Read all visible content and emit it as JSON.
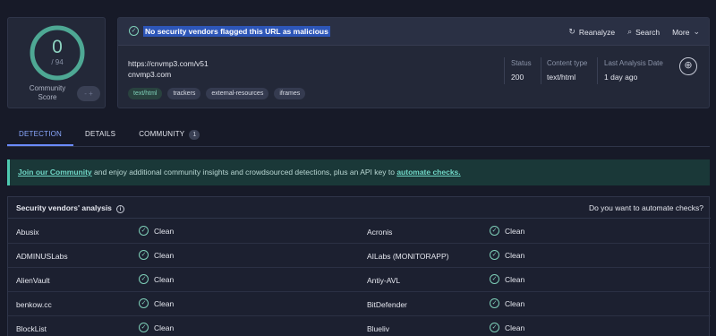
{
  "score": {
    "value": "0",
    "total": "/ 94",
    "community_label": "Community Score",
    "toggle_icon": "- +"
  },
  "banner": {
    "icon": "check-circle-icon",
    "text": "No security vendors flagged this URL as malicious",
    "actions": [
      {
        "label": "Reanalyze",
        "icon": "↻"
      },
      {
        "label": "Search",
        "icon": "⌕"
      },
      {
        "label": "More",
        "icon": "⌄"
      }
    ]
  },
  "target": {
    "url": "https://cnvmp3.com/v51",
    "domain": "cnvmp3.com",
    "tags": [
      "text/html",
      "trackers",
      "external-resources",
      "iframes"
    ]
  },
  "meta": [
    {
      "label": "Status",
      "value": "200"
    },
    {
      "label": "Content type",
      "value": "text/html"
    },
    {
      "label": "Last Analysis Date",
      "value": "1 day ago"
    }
  ],
  "tabs": [
    {
      "label": "DETECTION",
      "active": true
    },
    {
      "label": "DETAILS",
      "active": false
    },
    {
      "label": "COMMUNITY",
      "active": false,
      "badge": "1"
    }
  ],
  "promo": {
    "link1": "Join our Community",
    "middle": " and enjoy additional community insights and crowdsourced detections, plus an API key to ",
    "link2": "automate checks."
  },
  "vendors": {
    "title": "Security vendors' analysis",
    "automate_question": "Do you want to automate checks?",
    "rows": [
      {
        "left": "Abusix",
        "left_verdict": "Clean",
        "right": "Acronis",
        "right_verdict": "Clean"
      },
      {
        "left": "ADMINUSLabs",
        "left_verdict": "Clean",
        "right": "AILabs (MONITORAPP)",
        "right_verdict": "Clean"
      },
      {
        "left": "AlienVault",
        "left_verdict": "Clean",
        "right": "Antiy-AVL",
        "right_verdict": "Clean"
      },
      {
        "left": "benkow.cc",
        "left_verdict": "Clean",
        "right": "BitDefender",
        "right_verdict": "Clean"
      },
      {
        "left": "BlockList",
        "left_verdict": "Clean",
        "right": "Blueliv",
        "right_verdict": "Clean"
      }
    ]
  },
  "colors": {
    "accent": "#6b8bff",
    "clean": "#7ecfb8",
    "banner_highlight": "#2d56b8"
  }
}
